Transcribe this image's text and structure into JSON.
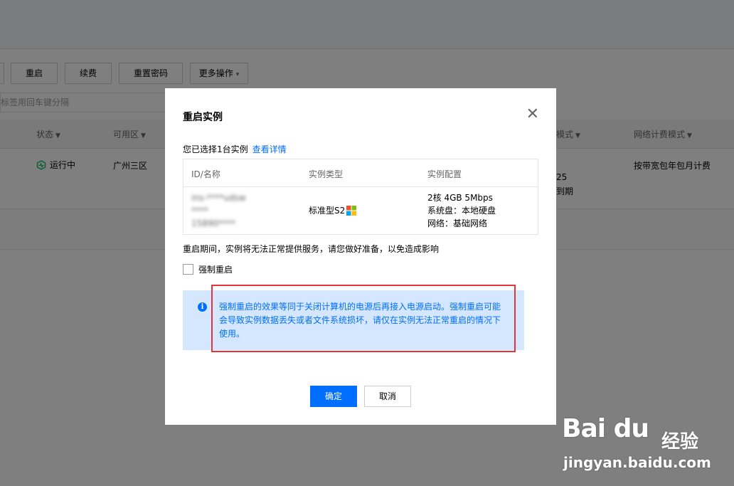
{
  "toolbar": {
    "buttons": [
      "重启",
      "续费",
      "重置密码",
      "更多操作"
    ]
  },
  "search": {
    "placeholder": "标签用回车键分隔"
  },
  "table": {
    "columns": [
      "状态",
      "可用区",
      "模式",
      "网络计费模式"
    ],
    "row": {
      "status": "运行中",
      "zone": "广州三区",
      "partial_1": "25",
      "partial_2": "到期",
      "billing": "按带宽包年包月计费"
    }
  },
  "modal": {
    "title": "重启实例",
    "selected_text": "您已选择1台实例",
    "details_link": "查看详情",
    "columns": [
      "ID/名称",
      "实例类型",
      "实例配置"
    ],
    "instance": {
      "id": "ins-****udsw",
      "name": "****",
      "extra": "15890****",
      "type": "标准型S2",
      "config_line1": "2核 4GB 5Mbps",
      "config_line2": "系统盘：本地硬盘",
      "config_line3": "网络：基础网络"
    },
    "notice": "重启期间，实例将无法正常提供服务，请您做好准备，以免造成影响",
    "force_label": "强制重启",
    "info": "强制重启的效果等同于关闭计算机的电源后再接入电源启动。强制重启可能会导致实例数据丢失或者文件系统损坏，请仅在实例无法正常重启的情况下使用。",
    "ok": "确定",
    "cancel": "取消"
  },
  "watermark": {
    "logo": "Bai du",
    "text": "经验",
    "url": "jingyan.baidu.com"
  },
  "colors": {
    "primary": "#006eff",
    "info_bg": "#d5e7ff",
    "highlight": "#e5323b",
    "running": "#0abf5b"
  }
}
